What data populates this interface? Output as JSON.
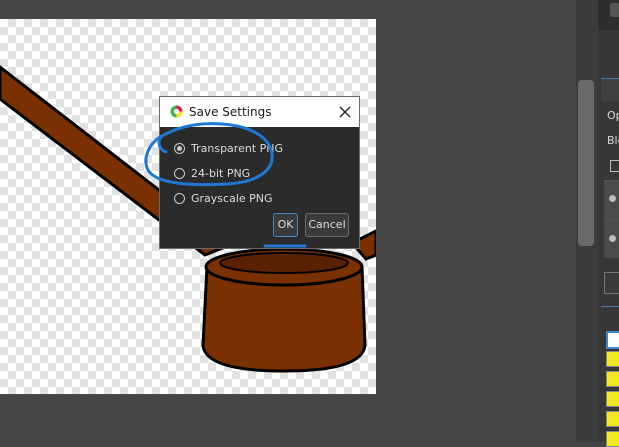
{
  "dialog": {
    "title": "Save Settings",
    "icon": "app-icon",
    "close_icon": "close-icon",
    "options": [
      {
        "label": "Transparent PNG",
        "selected": true
      },
      {
        "label": "24-bit PNG",
        "selected": false
      },
      {
        "label": "Grayscale PNG",
        "selected": false
      }
    ],
    "ok_label": "OK",
    "cancel_label": "Cancel"
  },
  "right_panel": {
    "text_1": "Op",
    "text_2": "Ble"
  },
  "colors": {
    "workspace": "#444444",
    "dialog_bg": "#2b2b2b",
    "accent": "#3f89cf",
    "annotation": "#1f78d1",
    "artwork_brown": "#7b3000",
    "swatch_yellow": "#f2ea1e"
  }
}
